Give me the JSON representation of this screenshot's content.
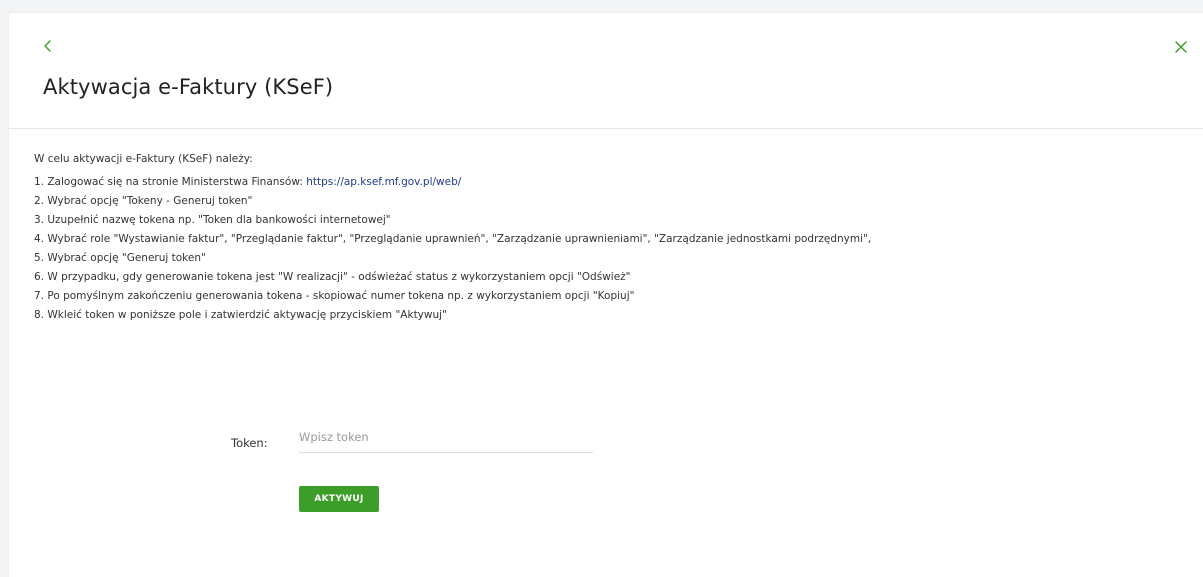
{
  "header": {
    "title": "Aktywacja e-Faktury (KSeF)",
    "accent_color": "#3c9e28",
    "back_icon": "chevron-left-icon",
    "close_icon": "close-icon"
  },
  "instructions": {
    "intro": "W celu aktywacji e-Faktury (KSeF) należy:",
    "step1_text": "1. Zalogować się na stronie Ministerstwa Finansów: ",
    "step1_link": "https://ap.ksef.mf.gov.pl/web/",
    "steps": [
      "2. Wybrać opcję \"Tokeny - Generuj token\"",
      "3. Uzupełnić nazwę tokena np. \"Token dla bankowości internetowej\"",
      "4. Wybrać role \"Wystawianie faktur\", \"Przeglądanie faktur\", \"Przeglądanie uprawnień\", \"Zarządzanie uprawnieniami\", \"Zarządzanie jednostkami podrzędnymi\",",
      "5. Wybrać opcję \"Generuj token\"",
      "6. W przypadku, gdy generowanie tokena jest \"W realizacji\" - odświeżać status z wykorzystaniem opcji \"Odśwież\"",
      "7. Po pomyślnym zakończeniu generowania tokena - skopiować numer tokena np. z wykorzystaniem opcji \"Kopiuj\"",
      "8. Wkleić token w poniższe pole i zatwierdzić aktywację przyciskiem \"Aktywuj\""
    ]
  },
  "form": {
    "token_label": "Token:",
    "token_value": "",
    "token_placeholder": "Wpisz token",
    "activate_label": "AKTYWUJ"
  }
}
